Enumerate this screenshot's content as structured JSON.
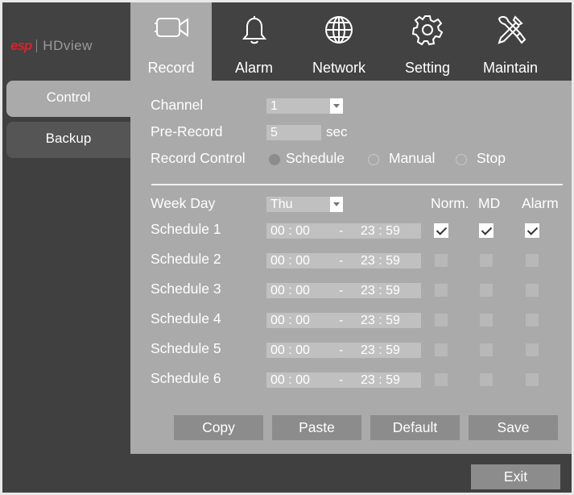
{
  "brand": {
    "esp": "esp",
    "name": "HDview"
  },
  "tabs": [
    {
      "label": "Record",
      "icon": "video-camera-icon",
      "active": true
    },
    {
      "label": "Alarm",
      "icon": "bell-icon"
    },
    {
      "label": "Network",
      "icon": "globe-icon"
    },
    {
      "label": "Setting",
      "icon": "gear-icon"
    },
    {
      "label": "Maintain",
      "icon": "tools-icon"
    }
  ],
  "sidebar": {
    "items": [
      {
        "label": "Control",
        "active": true
      },
      {
        "label": "Backup"
      }
    ]
  },
  "form": {
    "channel": {
      "label": "Channel",
      "value": "1"
    },
    "pre_record": {
      "label": "Pre-Record",
      "value": "5",
      "unit": "sec"
    },
    "record_control": {
      "label": "Record Control",
      "options": [
        "Schedule",
        "Manual",
        "Stop"
      ],
      "selected": "Schedule"
    },
    "week_day": {
      "label": "Week Day",
      "value": "Thu"
    },
    "columns": {
      "norm": "Norm.",
      "md": "MD",
      "alarm": "Alarm"
    },
    "schedules": [
      {
        "label": "Schedule 1",
        "start": "00 : 00",
        "sep": "-",
        "end": "23 : 59",
        "norm": true,
        "md": true,
        "alarm": true
      },
      {
        "label": "Schedule 2",
        "start": "00 : 00",
        "sep": "-",
        "end": "23 : 59",
        "norm": false,
        "md": false,
        "alarm": false
      },
      {
        "label": "Schedule 3",
        "start": "00 : 00",
        "sep": "-",
        "end": "23 : 59",
        "norm": false,
        "md": false,
        "alarm": false
      },
      {
        "label": "Schedule 4",
        "start": "00 : 00",
        "sep": "-",
        "end": "23 : 59",
        "norm": false,
        "md": false,
        "alarm": false
      },
      {
        "label": "Schedule 5",
        "start": "00 : 00",
        "sep": "-",
        "end": "23 : 59",
        "norm": false,
        "md": false,
        "alarm": false
      },
      {
        "label": "Schedule 6",
        "start": "00 : 00",
        "sep": "-",
        "end": "23 : 59",
        "norm": false,
        "md": false,
        "alarm": false
      }
    ]
  },
  "buttons": {
    "copy": "Copy",
    "paste": "Paste",
    "default": "Default",
    "save": "Save",
    "exit": "Exit"
  },
  "colors": {
    "accent": "#d8232a",
    "panel": "#aaaaaa",
    "chrome": "#404040"
  }
}
